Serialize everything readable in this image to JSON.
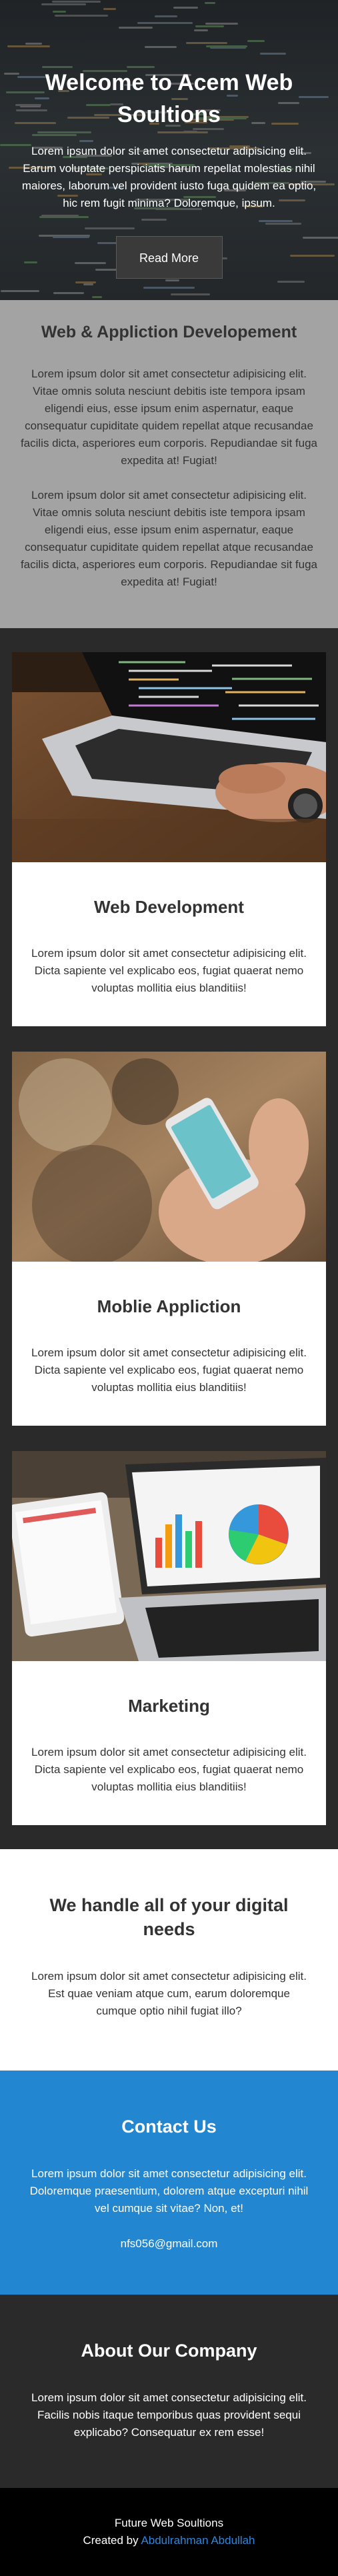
{
  "hero": {
    "title": "Welcome to Acem Web Soultions",
    "text": "Lorem ipsum dolor sit amet consectetur adipisicing elit. Earum voluptate perspiciatis harum repellat molestias nihil maiores, laborum vel provident iusto fuga quidem ea optio, hic rem fugit minima? Doloremque, ipsum.",
    "button_label": "Read More"
  },
  "intro": {
    "title": "Web & Appliction Developement",
    "paragraphs": [
      "Lorem ipsum dolor sit amet consectetur adipisicing elit. Vitae omnis soluta nesciunt debitis iste tempora ipsam eligendi eius, esse ipsum enim aspernatur, eaque consequatur cupiditate quidem repellat atque recusandae facilis dicta, asperiores eum corporis. Repudiandae sit fuga expedita at! Fugiat!",
      "Lorem ipsum dolor sit amet consectetur adipisicing elit. Vitae omnis soluta nesciunt debitis iste tempora ipsam eligendi eius, esse ipsum enim aspernatur, eaque consequatur cupiditate quidem repellat atque recusandae facilis dicta, asperiores eum corporis. Repudiandae sit fuga expedita at! Fugiat!"
    ]
  },
  "cards": [
    {
      "title": "Web Development",
      "text": "Lorem ipsum dolor sit amet consectetur adipisicing elit. Dicta sapiente vel explicabo eos, fugiat quaerat nemo voluptas mollitia eius blanditiis!"
    },
    {
      "title": "Moblie Appliction",
      "text": "Lorem ipsum dolor sit amet consectetur adipisicing elit. Dicta sapiente vel explicabo eos, fugiat quaerat nemo voluptas mollitia eius blanditiis!"
    },
    {
      "title": "Marketing",
      "text": "Lorem ipsum dolor sit amet consectetur adipisicing elit. Dicta sapiente vel explicabo eos, fugiat quaerat nemo voluptas mollitia eius blanditiis!"
    }
  ],
  "needs": {
    "title": "We handle all of your digital needs",
    "text": "Lorem ipsum dolor sit amet consectetur adipisicing elit. Est quae veniam atque cum, earum doloremque cumque optio nihil fugiat illo?"
  },
  "contact": {
    "title": "Contact Us",
    "text": "Lorem ipsum dolor sit amet consectetur adipisicing elit. Doloremque praesentium, dolorem atque excepturi nihil vel cumque sit vitae? Non, et!",
    "email": "nfs056@gmail.com"
  },
  "company": {
    "title": "About Our Company",
    "text": "Lorem ipsum dolor sit amet consectetur adipisicing elit. Facilis nobis itaque temporibus quas provident sequi explicabo? Consequatur ex rem esse!"
  },
  "footer": {
    "line1": "Future Web Soultions",
    "created_by_prefix": "Created by",
    "author": "Abdulrahman Abdullah"
  },
  "colors": {
    "accent_blue": "#2286d1",
    "grey_section": "#a3a3a3",
    "dark_bg": "#2a2a2a",
    "link": "#2e86de"
  }
}
